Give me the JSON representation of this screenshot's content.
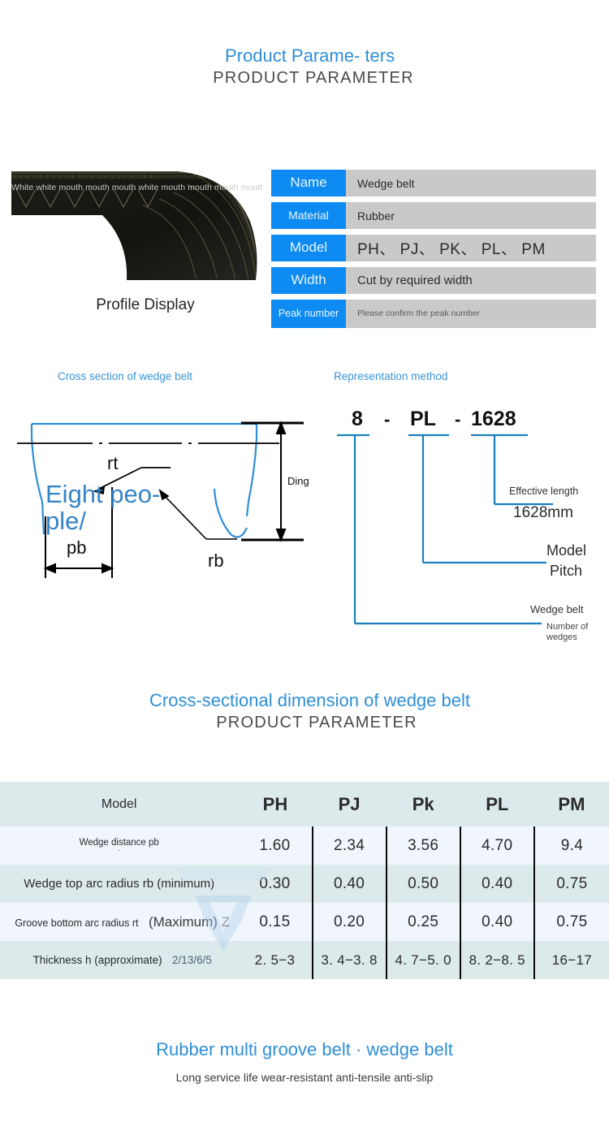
{
  "sections": {
    "header_1": {
      "title_cn": "Product Parame-\nters",
      "title_en": "PRODUCT PARAMETER"
    },
    "header_2": {
      "title_cn": "Cross-sectional dimension of wedge belt",
      "title_en": "PRODUCT PARAMETER"
    }
  },
  "photo": {
    "caption": "Profile Display",
    "watermark": "White white mouth mouth mouth white mouth mouth mouth mouth mouth"
  },
  "spec_table": {
    "rows": [
      {
        "key": "Name",
        "value": "Wedge belt"
      },
      {
        "key": "Material",
        "value": "Rubber"
      },
      {
        "key": "Model",
        "value": "PH、 PJ、 PK、 PL、 PM"
      },
      {
        "key": "Width",
        "value": "Cut by required width"
      },
      {
        "key": "Peak number",
        "value": "Please confirm the peak number"
      }
    ]
  },
  "cross_section": {
    "title": "Cross section of wedge belt",
    "watermark": "Eight peo-\nple/",
    "labels": {
      "rt": "rt",
      "rb": "rb",
      "pb": "pb",
      "height": "Ding"
    }
  },
  "representation": {
    "title": "Representation method",
    "code": {
      "part1": "8",
      "dash1": "-",
      "part2": "PL",
      "dash2": "-",
      "part3": "1628"
    },
    "callouts": {
      "effective_length": "Effective length",
      "effective_length_value": "1628mm",
      "model": "Model",
      "pitch": "Pitch",
      "wedge_belt": "Wedge belt",
      "number_of_wedges": "Number of wedges"
    }
  },
  "chart_data": {
    "type": "table",
    "title": "Cross-sectional dimension of wedge belt",
    "columns": [
      "Model",
      "PH",
      "PJ",
      "Pk",
      "PL",
      "PM"
    ],
    "rows": [
      {
        "label": "Wedge distance pb",
        "label_suffix": "·",
        "values": [
          "1.60",
          "2.34",
          "3.56",
          "4.70",
          "9.4"
        ]
      },
      {
        "label": "Wedge top arc radius rb (minimum)",
        "label_suffix": "",
        "values": [
          "0.30",
          "0.40",
          "0.50",
          "0.40",
          "0.75"
        ]
      },
      {
        "label": "Groove bottom arc radius rt",
        "label_suffix": "(Maximum) Z",
        "values": [
          "0.15",
          "0.20",
          "0.25",
          "0.40",
          "0.75"
        ]
      },
      {
        "label": "Thickness h (approximate)",
        "label_suffix": "2/13/6/5",
        "values": [
          "2. 5−3",
          "3. 4−3. 8",
          "4. 7−5. 0",
          "8. 2−8. 5",
          "16−17"
        ]
      }
    ]
  },
  "footer": {
    "title": "Rubber multi groove belt · wedge belt",
    "subtitle": "Long service life wear-resistant anti-tensile anti-slip"
  },
  "colors": {
    "accent_blue": "#2f8fd6",
    "key_blue": "#0d8bf2",
    "value_gray": "#c9c9c9",
    "row_teal": "#dceaec",
    "row_light": "#f1f5fc",
    "diagram_blue": "#2e8fd4"
  }
}
